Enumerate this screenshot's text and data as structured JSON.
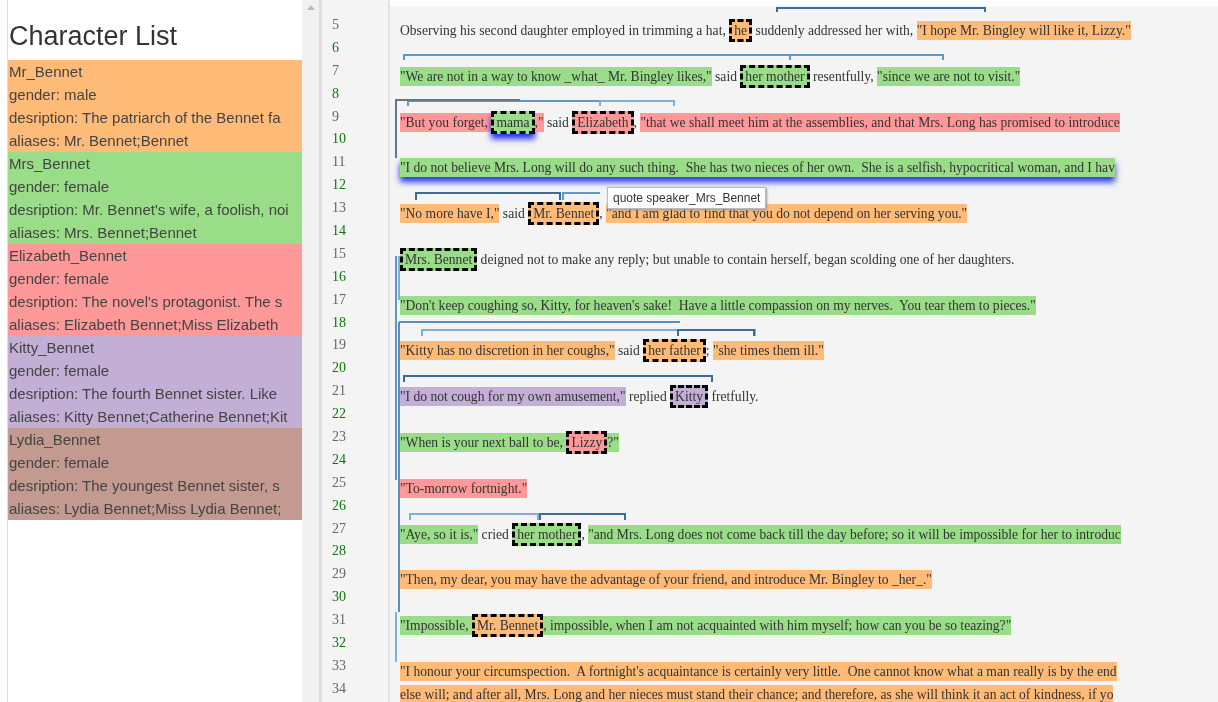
{
  "character_list": {
    "title": "Character List",
    "characters": [
      {
        "name": "Mr_Bennet",
        "color": "#ffbb77",
        "details": [
          "gender: male",
          "desription: The patriarch of the Bennet fa",
          "aliases: Mr. Bennet;Bennet"
        ]
      },
      {
        "name": "Mrs_Bennet",
        "color": "#99dd88",
        "details": [
          "gender: female",
          "desription: Mr. Bennet's wife, a foolish, noi",
          "aliases: Mrs. Bennet;Bennet"
        ]
      },
      {
        "name": "Elizabeth_Bennet",
        "color": "#ff9999",
        "details": [
          "gender: female",
          "desription: The novel's protagonist. The s",
          "aliases: Elizabeth Bennet;Miss Elizabeth"
        ]
      },
      {
        "name": "Kitty_Bennet",
        "color": "#c3aed6",
        "details": [
          "gender: female",
          "desription: The fourth Bennet sister. Like",
          "aliases: Kitty Bennet;Catherine Bennet;Kit"
        ]
      },
      {
        "name": "Lydia_Bennet",
        "color": "#c29a90",
        "details": [
          "gender: female",
          "desription: The youngest Bennet sister, s",
          "aliases: Lydia Bennet;Miss Lydia Bennet;"
        ]
      }
    ]
  },
  "tooltip": "quote speaker_Mrs_Bennet",
  "lines": [
    {
      "number": "5",
      "segments": [
        {
          "kind": "plain",
          "text": "Observing his second daughter employed in trimming a hat, "
        },
        {
          "kind": "mention",
          "text": "he",
          "color": "#ffbb77",
          "highlighted": false
        },
        {
          "kind": "plain",
          "text": " suddenly addressed her with, "
        },
        {
          "kind": "quote",
          "text": "\"I hope Mr. Bingley will like it, Lizzy.\"",
          "color": "#ffbb77",
          "highlighted": false
        }
      ]
    },
    {
      "number": "6"
    },
    {
      "number": "7",
      "segments": [
        {
          "kind": "quote",
          "text": "\"We are not in a way to know _what_ Mr. Bingley likes,\"",
          "color": "#99dd88",
          "highlighted": false
        },
        {
          "kind": "plain",
          "text": " said "
        },
        {
          "kind": "mention",
          "text": "her mother",
          "color": "#99dd88",
          "highlighted": false
        },
        {
          "kind": "plain",
          "text": " resentfully, "
        },
        {
          "kind": "quote",
          "text": "\"since we are not to visit.\"",
          "color": "#99dd88",
          "highlighted": false
        }
      ]
    },
    {
      "number": "8"
    },
    {
      "number": "9",
      "segments": [
        {
          "kind": "quote",
          "text": "\"But you forget, ",
          "color": "#ff9999",
          "highlighted": false
        },
        {
          "kind": "mention",
          "text": "mama",
          "color": "#99dd88",
          "highlighted": true
        },
        {
          "kind": "quote",
          "text": ",\"",
          "color": "#ff9999",
          "highlighted": false
        },
        {
          "kind": "plain",
          "text": " said "
        },
        {
          "kind": "mention",
          "text": "Elizabeth",
          "color": "#ff9999",
          "highlighted": false
        },
        {
          "kind": "plain",
          "text": ", "
        },
        {
          "kind": "quote",
          "text": "\"that we shall meet him at the assemblies, and that Mrs. Long has promised to introduce",
          "color": "#ff9999",
          "highlighted": false
        }
      ]
    },
    {
      "number": "10"
    },
    {
      "number": "11",
      "segments": [
        {
          "kind": "quote",
          "text": "\"I do not believe Mrs. Long will do any such thing.  She has two nieces of her own.  She is a selfish, hypocritical woman, and I hav",
          "color": "#99dd88",
          "highlighted": true
        }
      ]
    },
    {
      "number": "12"
    },
    {
      "number": "13",
      "segments": [
        {
          "kind": "quote",
          "text": "\"No more have I,\"",
          "color": "#ffbb77",
          "highlighted": false
        },
        {
          "kind": "plain",
          "text": " said "
        },
        {
          "kind": "mention",
          "text": "Mr. Bennet",
          "color": "#ffbb77",
          "highlighted": false
        },
        {
          "kind": "plain",
          "text": ", "
        },
        {
          "kind": "quote",
          "text": "\"and I am glad to find that you do not depend on her serving you.\"",
          "color": "#ffbb77",
          "highlighted": false
        }
      ]
    },
    {
      "number": "14"
    },
    {
      "number": "15",
      "segments": [
        {
          "kind": "mention",
          "text": "Mrs. Bennet",
          "color": "#99dd88",
          "highlighted": false
        },
        {
          "kind": "plain",
          "text": " deigned not to make any reply; but unable to contain herself, began scolding one of her daughters."
        }
      ]
    },
    {
      "number": "16"
    },
    {
      "number": "17",
      "segments": [
        {
          "kind": "quote",
          "text": "\"Don't keep coughing so, Kitty, for heaven's sake!  Have a little compassion on my nerves.  You tear them to pieces.\"",
          "color": "#99dd88",
          "highlighted": false
        }
      ]
    },
    {
      "number": "18"
    },
    {
      "number": "19",
      "segments": [
        {
          "kind": "quote",
          "text": "\"Kitty has no discretion in her coughs,\"",
          "color": "#ffbb77",
          "highlighted": false
        },
        {
          "kind": "plain",
          "text": " said "
        },
        {
          "kind": "mention",
          "text": "her father",
          "color": "#ffbb77",
          "highlighted": false
        },
        {
          "kind": "plain",
          "text": "; "
        },
        {
          "kind": "quote",
          "text": "\"she times them ill.\"",
          "color": "#ffbb77",
          "highlighted": false
        }
      ]
    },
    {
      "number": "20"
    },
    {
      "number": "21",
      "segments": [
        {
          "kind": "quote",
          "text": "\"I do not cough for my own amusement,\"",
          "color": "#c3aed6",
          "highlighted": false
        },
        {
          "kind": "plain",
          "text": " replied "
        },
        {
          "kind": "mention",
          "text": "Kitty",
          "color": "#c3aed6",
          "highlighted": false
        },
        {
          "kind": "plain",
          "text": " fretfully."
        }
      ]
    },
    {
      "number": "22"
    },
    {
      "number": "23",
      "segments": [
        {
          "kind": "quote",
          "text": "\"When is your next ball to be, ",
          "color": "#99dd88",
          "highlighted": false
        },
        {
          "kind": "mention",
          "text": "Lizzy",
          "color": "#ff9999",
          "highlighted": false
        },
        {
          "kind": "quote",
          "text": "?\"",
          "color": "#99dd88",
          "highlighted": false
        }
      ]
    },
    {
      "number": "24"
    },
    {
      "number": "25",
      "segments": [
        {
          "kind": "quote",
          "text": "\"To-morrow fortnight.\"",
          "color": "#ff9999",
          "highlighted": false
        }
      ]
    },
    {
      "number": "26"
    },
    {
      "number": "27",
      "segments": [
        {
          "kind": "quote",
          "text": "\"Aye, so it is,\"",
          "color": "#99dd88",
          "highlighted": false
        },
        {
          "kind": "plain",
          "text": " cried "
        },
        {
          "kind": "mention",
          "text": "her mother",
          "color": "#99dd88",
          "highlighted": false
        },
        {
          "kind": "plain",
          "text": ", "
        },
        {
          "kind": "quote",
          "text": "\"and Mrs. Long does not come back till the day before; so it will be impossible for her to introduc",
          "color": "#99dd88",
          "highlighted": false
        }
      ]
    },
    {
      "number": "28"
    },
    {
      "number": "29",
      "segments": [
        {
          "kind": "quote",
          "text": "\"Then, my dear, you may have the advantage of your friend, and introduce Mr. Bingley to _her_.\"",
          "color": "#ffbb77",
          "highlighted": false
        }
      ]
    },
    {
      "number": "30"
    },
    {
      "number": "31",
      "segments": [
        {
          "kind": "quote",
          "text": "\"Impossible, ",
          "color": "#99dd88",
          "highlighted": false
        },
        {
          "kind": "mention",
          "text": "Mr. Bennet",
          "color": "#ffbb77",
          "highlighted": false
        },
        {
          "kind": "quote",
          "text": ", impossible, when I am not acquainted with him myself; how can you be so teazing?\"",
          "color": "#99dd88",
          "highlighted": false
        }
      ]
    },
    {
      "number": "32"
    },
    {
      "number": "33",
      "segments": [
        {
          "kind": "quote",
          "text": "\"I honour your circumspection.  A fortnight's acquaintance is certainly very little.  One cannot know what a man really is by the end",
          "color": "#ffbb77",
          "highlighted": false
        }
      ]
    },
    {
      "number": "34",
      "segments": [
        {
          "kind": "quote",
          "text": "else will; and after all, Mrs. Long and her nieces must stand their chance; and therefore, as she will think it an act of kindness, if yo",
          "color": "#ffbb77",
          "highlighted": false
        }
      ]
    }
  ]
}
